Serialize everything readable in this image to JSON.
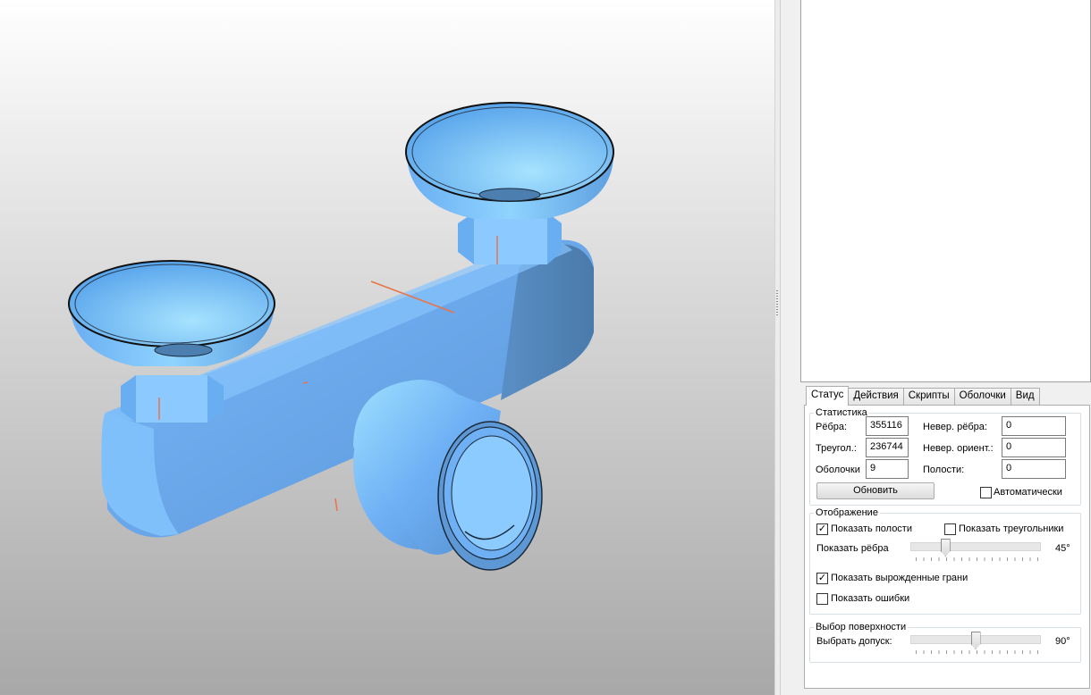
{
  "tabs": [
    {
      "label": "Статус",
      "active": true
    },
    {
      "label": "Действия",
      "active": false
    },
    {
      "label": "Скрипты",
      "active": false
    },
    {
      "label": "Оболочки",
      "active": false
    },
    {
      "label": "Вид",
      "active": false
    }
  ],
  "statistics": {
    "legend": "Статистика",
    "edges_label": "Рёбра:",
    "edges_value": "355116",
    "triangles_label": "Треугол.:",
    "triangles_value": "236744",
    "shells_label": "Оболочки",
    "shells_value": "9",
    "bad_edges_label": "Невер. рёбра:",
    "bad_edges_value": "0",
    "bad_orient_label": "Невер. ориент.:",
    "bad_orient_value": "0",
    "holes_label": "Полости:",
    "holes_value": "0",
    "update_button": "Обновить",
    "auto_label": "Автоматически",
    "auto_checked": false
  },
  "display": {
    "legend": "Отображение",
    "show_holes_label": "Показать полости",
    "show_holes_checked": true,
    "show_triangles_label": "Показать треугольники",
    "show_triangles_checked": false,
    "show_edges_label": "Показать рёбра",
    "show_edges_value": "45°",
    "show_edges_fraction": 0.25,
    "show_degenerate_label": "Показать вырожденные грани",
    "show_degenerate_checked": true,
    "show_errors_label": "Показать ошибки",
    "show_errors_checked": false
  },
  "surface": {
    "legend": "Выбор поверхности",
    "tolerance_label": "Выбрать допуск:",
    "tolerance_value": "90°",
    "tolerance_fraction": 0.5
  },
  "colors": {
    "model_light": "#8fd0ff",
    "model_mid": "#6fb0f5",
    "model_dark": "#4f84b8",
    "error_edges": "#e8744a"
  }
}
